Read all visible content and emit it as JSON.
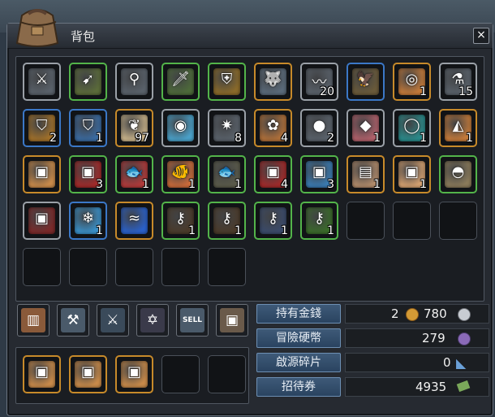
{
  "window": {
    "title": "背包",
    "close_label": "×"
  },
  "inventory_rows": [
    [
      {
        "name": "sword",
        "glyph": "⚔",
        "bg": "#59616a",
        "border": "#9aa0a7",
        "qty": ""
      },
      {
        "name": "bow",
        "glyph": "➹",
        "bg": "#5b6b3a",
        "border": "#53b44a",
        "qty": ""
      },
      {
        "name": "fishing-rod",
        "glyph": "⚲",
        "bg": "#59616a",
        "border": "#9aa0a7",
        "qty": ""
      },
      {
        "name": "knife",
        "glyph": "🗡",
        "bg": "#4d6a3a",
        "border": "#53b44a",
        "qty": ""
      },
      {
        "name": "shield",
        "glyph": "⛨",
        "bg": "#8a6a2a",
        "border": "#53b44a",
        "qty": ""
      },
      {
        "name": "wolf-card",
        "glyph": "🐺",
        "bg": "#5a6a7a",
        "border": "#c78a2a",
        "qty": ""
      },
      {
        "name": "worm",
        "glyph": "〰",
        "bg": "#59616a",
        "border": "#9aa0a7",
        "qty": "20"
      },
      {
        "name": "bird",
        "glyph": "🦅",
        "bg": "#6a5a3a",
        "border": "#3b78c7",
        "qty": ""
      },
      {
        "name": "spiral-shell",
        "glyph": "◎",
        "bg": "#c47a3a",
        "border": "#c78a2a",
        "qty": "1"
      },
      {
        "name": "potion",
        "glyph": "⚗",
        "bg": "#59616a",
        "border": "#9aa0a7",
        "qty": "15"
      }
    ],
    [
      {
        "name": "crest-shield",
        "glyph": "⛉",
        "bg": "#a0702a",
        "border": "#3b78c7",
        "qty": "2"
      },
      {
        "name": "crest-shield-2",
        "glyph": "⛉",
        "bg": "#3a6aa0",
        "border": "#3b78c7",
        "qty": "1"
      },
      {
        "name": "wings",
        "glyph": "❦",
        "bg": "#c9b38a",
        "border": "#c78a2a",
        "qty": "97"
      },
      {
        "name": "crystal-orb",
        "glyph": "◉",
        "bg": "#4aa0c8",
        "border": "#9aa0a7",
        "qty": ""
      },
      {
        "name": "star-gem",
        "glyph": "✷",
        "bg": "#59616a",
        "border": "#9aa0a7",
        "qty": "8"
      },
      {
        "name": "flower-gem",
        "glyph": "✿",
        "bg": "#b0703a",
        "border": "#c78a2a",
        "qty": "4"
      },
      {
        "name": "green-orb",
        "glyph": "●",
        "bg": "#59616a",
        "border": "#9aa0a7",
        "qty": "2"
      },
      {
        "name": "pink-crystal",
        "glyph": "◆",
        "bg": "#b0606a",
        "border": "#9aa0a7",
        "qty": "1"
      },
      {
        "name": "teal-ring",
        "glyph": "◯",
        "bg": "#2a8a8a",
        "border": "#9aa0a7",
        "qty": "1"
      },
      {
        "name": "orange-ore",
        "glyph": "◭",
        "bg": "#c47a3a",
        "border": "#c78a2a",
        "qty": "1"
      }
    ],
    [
      {
        "name": "golden-chest",
        "glyph": "▣",
        "bg": "#c88a4a",
        "border": "#c78a2a",
        "qty": ""
      },
      {
        "name": "red-chest",
        "glyph": "▣",
        "bg": "#a02a2a",
        "border": "#53b44a",
        "qty": "3"
      },
      {
        "name": "red-fish",
        "glyph": "🐟",
        "bg": "#b03a3a",
        "border": "#53b44a",
        "qty": "1"
      },
      {
        "name": "koi-fish",
        "glyph": "🐠",
        "bg": "#c86a3a",
        "border": "#53b44a",
        "qty": "1"
      },
      {
        "name": "catfish",
        "glyph": "🐟",
        "bg": "#5a5a4a",
        "border": "#53b44a",
        "qty": "1"
      },
      {
        "name": "red-chest-2",
        "glyph": "▣",
        "bg": "#a02a2a",
        "border": "#53b44a",
        "qty": "4"
      },
      {
        "name": "blue-chest",
        "glyph": "▣",
        "bg": "#3a7ab0",
        "border": "#53b44a",
        "qty": "3"
      },
      {
        "name": "map-scroll",
        "glyph": "▤",
        "bg": "#b08a6a",
        "border": "#c78a2a",
        "qty": "1"
      },
      {
        "name": "parchment-chest",
        "glyph": "▣",
        "bg": "#d4a070",
        "border": "#c78a2a",
        "qty": "1"
      },
      {
        "name": "pouch",
        "glyph": "◓",
        "bg": "#8a7a5a",
        "border": "#53b44a",
        "qty": ""
      }
    ],
    [
      {
        "name": "dark-chest",
        "glyph": "▣",
        "bg": "#7a2a2a",
        "border": "#9aa0a7",
        "qty": ""
      },
      {
        "name": "ice-flower",
        "glyph": "❄",
        "bg": "#3a90c8",
        "border": "#3b78c7",
        "qty": "1"
      },
      {
        "name": "water-waves",
        "glyph": "≈",
        "bg": "#2a60c8",
        "border": "#c78a2a",
        "qty": ""
      },
      {
        "name": "flame-key",
        "glyph": "⚷",
        "bg": "#4a3a2a",
        "border": "#53b44a",
        "qty": "1"
      },
      {
        "name": "flame-key-2",
        "glyph": "⚷",
        "bg": "#4a3a2a",
        "border": "#53b44a",
        "qty": "1"
      },
      {
        "name": "blue-key",
        "glyph": "⚷",
        "bg": "#3a4a6a",
        "border": "#53b44a",
        "qty": "1"
      },
      {
        "name": "green-key",
        "glyph": "⚷",
        "bg": "#3a6a2a",
        "border": "#53b44a",
        "qty": "1"
      },
      null,
      null,
      null
    ],
    [
      null,
      null,
      null,
      null,
      null
    ]
  ],
  "tools": [
    {
      "name": "wood-plank-tool",
      "glyph": "▥",
      "bg": "#8a5a3a"
    },
    {
      "name": "magnifier-tool",
      "glyph": "⚒",
      "bg": "#4a5a6a"
    },
    {
      "name": "sword-sparkle-tool",
      "glyph": "⚔",
      "bg": "#3a4a5a"
    },
    {
      "name": "magic-circle-tool",
      "glyph": "✡",
      "bg": "#3a3a4a"
    },
    {
      "name": "sell-tool",
      "glyph": "SELL",
      "bg": "#4a5a6a"
    },
    {
      "name": "chest-tool",
      "glyph": "▣",
      "bg": "#6a5a4a"
    }
  ],
  "lower_slots": [
    {
      "name": "golden-chest",
      "glyph": "▣",
      "bg": "#c88a4a",
      "border": "#c78a2a",
      "qty": ""
    },
    {
      "name": "golden-chest",
      "glyph": "▣",
      "bg": "#c88a4a",
      "border": "#c78a2a",
      "qty": ""
    },
    {
      "name": "golden-chest",
      "glyph": "▣",
      "bg": "#c88a4a",
      "border": "#c78a2a",
      "qty": ""
    },
    null,
    null
  ],
  "currencies": {
    "gold_label": "持有金錢",
    "gold_value": "2",
    "silver_value": "780",
    "coin_label": "冒險硬幣",
    "coin_value": "279",
    "shard_label": "啟源碎片",
    "shard_value": "0",
    "ticket_label": "招待券",
    "ticket_value": "4935"
  },
  "colors": {
    "gold_coin": "#d39a35",
    "silver_coin": "#c8ccd2",
    "adventure_coin": "#8a6ab8",
    "shard": "#6aa0d8",
    "ticket": "#7aa85a"
  }
}
